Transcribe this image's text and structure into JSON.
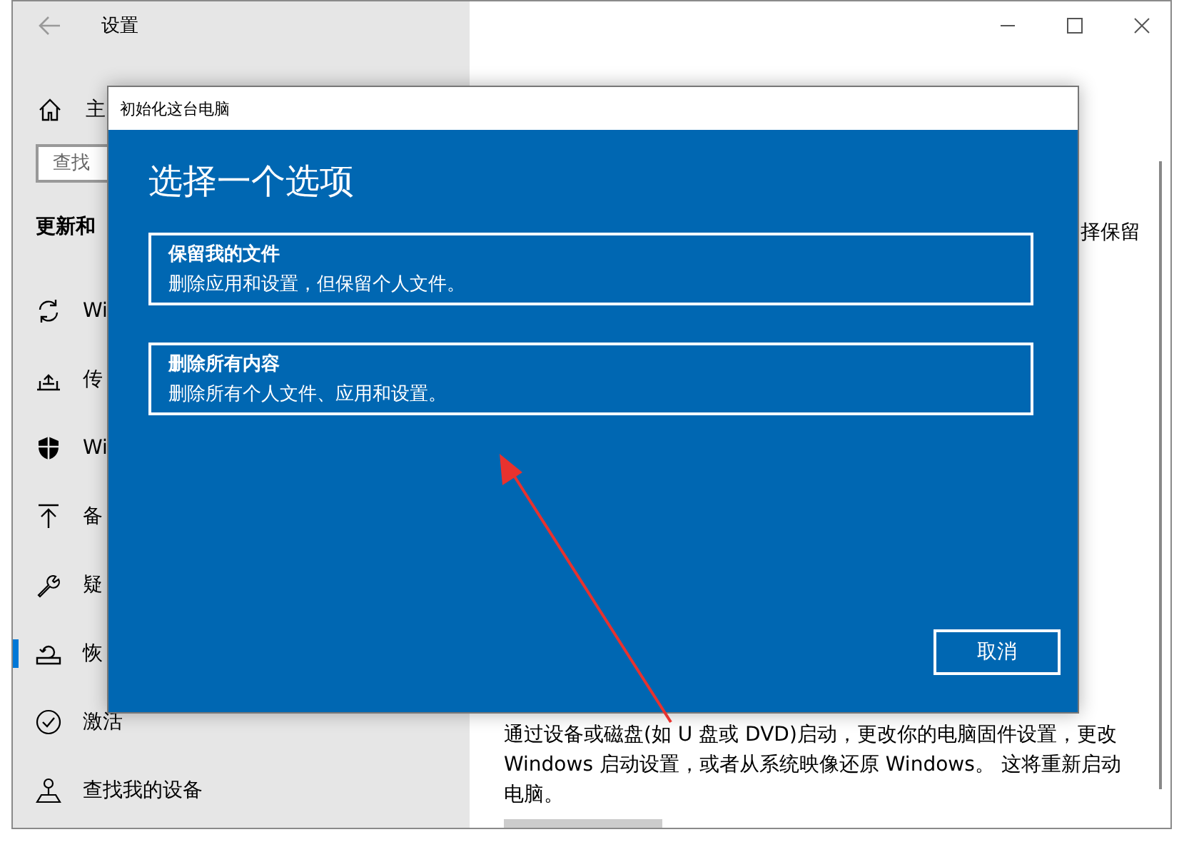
{
  "settings_window": {
    "title": "设置",
    "sidebar": {
      "home": "主",
      "search": {
        "placeholder": "查找"
      },
      "heading": "更新和",
      "items": [
        {
          "kind": "sync",
          "label": "Wi",
          "selected": false
        },
        {
          "kind": "delivery",
          "label": "传",
          "selected": false
        },
        {
          "kind": "shield",
          "label": "Wi",
          "selected": false
        },
        {
          "kind": "backup",
          "label": "备",
          "selected": false
        },
        {
          "kind": "wrench",
          "label": "疑",
          "selected": false
        },
        {
          "kind": "recovery",
          "label": "恢",
          "selected": true
        },
        {
          "kind": "activation",
          "label": "激活",
          "selected": false
        },
        {
          "kind": "find-device",
          "label": "查找我的设备",
          "selected": false
        }
      ]
    },
    "main": {
      "partial_text": "择保留",
      "description": "通过设备或磁盘(如 U 盘或 DVD)启动，更改你的电脑固件设置，更改 Windows 启动设置，或者从系统映像还原 Windows。 这将重新启动电脑。"
    }
  },
  "dialog": {
    "title": "初始化这台电脑",
    "heading": "选择一个选项",
    "options": [
      {
        "title": "保留我的文件",
        "description": "删除应用和设置，但保留个人文件。"
      },
      {
        "title": "删除所有内容",
        "description": "删除所有个人文件、应用和设置。"
      }
    ],
    "cancel": "取消"
  }
}
